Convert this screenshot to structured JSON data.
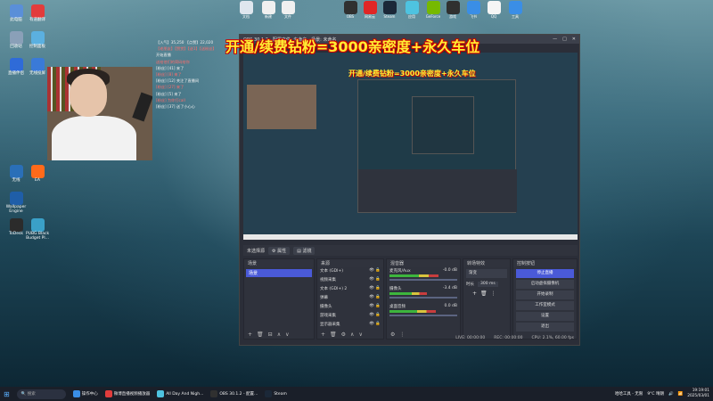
{
  "desktop": {
    "left_icons": [
      {
        "label": "此电脑",
        "color": "#5a8fd8",
        "icon": "computer-icon"
      },
      {
        "label": "有道翻译",
        "color": "#e23c3c",
        "icon": "youdao-icon"
      },
      {
        "label": "回收站",
        "color": "#8aa0b8",
        "icon": "recycle-bin-icon"
      },
      {
        "label": "控制面板",
        "color": "#5bb0e0",
        "icon": "control-panel-icon"
      },
      {
        "label": "直播伴侣",
        "color": "#2f6bd8",
        "icon": "app-icon"
      },
      {
        "label": "无线投屏",
        "color": "#3a7ad8",
        "icon": "cast-icon"
      },
      {
        "label": "无线",
        "color": "#2a6fb8",
        "icon": "wireless-icon"
      },
      {
        "label": "Wallpaper Engine",
        "color": "#1f5ea8",
        "icon": "wallpaper-engine-icon"
      },
      {
        "label": "EA",
        "color": "#ff6a1a",
        "icon": "ea-icon"
      },
      {
        "label": "ToDesk",
        "color": "#2b2b2b",
        "icon": "todesk-icon"
      },
      {
        "label": "PUBG Black Budget Pl...",
        "color": "#3aa0c8",
        "icon": "pubg-icon"
      }
    ],
    "top_icons": [
      {
        "label": "文档",
        "color": "#dfe6ee",
        "icon": "document-icon"
      },
      {
        "label": "新建",
        "color": "#f0f0f0",
        "icon": "file-icon"
      },
      {
        "label": "文件",
        "color": "#f0f0f0",
        "icon": "file-icon"
      },
      {
        "label": "OBS",
        "color": "#303030",
        "icon": "obs-icon"
      },
      {
        "label": "网易云",
        "color": "#e02626",
        "icon": "netease-music-icon"
      },
      {
        "label": "Steam",
        "color": "#1b2838",
        "icon": "steam-icon"
      },
      {
        "label": "应用",
        "color": "#4ec3e0",
        "icon": "app-icon"
      },
      {
        "label": "GeForce",
        "color": "#76b900",
        "icon": "nvidia-icon"
      },
      {
        "label": "游戏",
        "color": "#303030",
        "icon": "game-icon"
      },
      {
        "label": "飞书",
        "color": "#3a8ee6",
        "icon": "feishu-icon"
      },
      {
        "label": "QQ",
        "color": "#f5f5f5",
        "icon": "qq-icon"
      },
      {
        "label": "工具",
        "color": "#3a8ee6",
        "icon": "tool-icon"
      }
    ]
  },
  "overlay": {
    "banner": "开通/续费钻粉=3000亲密度+永久车位",
    "chat_lines": [
      "【入气】35,250 【点赞】22,020",
      "【老朋友】【赞赏】【送1】【送粉丝】",
      "开始直播",
      "送给他们的简码给你",
      "[粉丝] [41] 来了",
      "[粉丝] [8] 来了",
      "[粉丝] [12] 关注了直播间",
      "[粉丝] [27] 来了",
      "[粉丝] [5] 来了",
      "[粉丝] 为你打call",
      "[粉丝] [37] 送了小心心"
    ]
  },
  "obs": {
    "title": "OBS 30.1.2 - 配置文件: 未命名 - 场景: 未命名",
    "window_controls": [
      "—",
      "□",
      "✕"
    ],
    "preview_banner": "开通/续费钻粉=3000亲密度+永久车位",
    "toolbar": {
      "scene_label": "未选择源",
      "properties_label": "属性",
      "filters_label": "滤镜"
    },
    "scenes": {
      "header": "场景",
      "items": [
        "场景"
      ],
      "footer": [
        "+",
        "🗑",
        "⊟",
        "∧",
        "∨"
      ]
    },
    "sources": {
      "header": "来源",
      "items": [
        "文本 (GDI+)",
        "视频采集",
        "文本 (GDI+) 2",
        "弹幕",
        "摄像头",
        "游戏采集",
        "显示器采集"
      ],
      "footer": [
        "+",
        "🗑",
        "⚙",
        "∧",
        "∨"
      ]
    },
    "mixer": {
      "header": "混音器",
      "channels": [
        {
          "name": "麦克风/Aux",
          "db": "-0.0 dB",
          "level": 0.72
        },
        {
          "name": "摄像头",
          "db": "-3.4 dB",
          "level": 0.55
        },
        {
          "name": "桌面音频",
          "db": "0.0 dB",
          "level": 0.68
        }
      ]
    },
    "transitions": {
      "header": "转场特效",
      "type": "渐变",
      "duration_label": "时长",
      "duration_value": "300 ms"
    },
    "controls": {
      "header": "控制按钮",
      "buttons": [
        "停止直播",
        "启动虚拟摄像机",
        "开始录制",
        "工作室模式",
        "设置",
        "退出"
      ]
    },
    "status": {
      "live": "LIVE: 00:00:00",
      "rec": "REC: 00:00:00",
      "cpu": "CPU: 2.1%, 60.00 fps"
    }
  },
  "taskbar": {
    "search_placeholder": "搜索",
    "items": [
      {
        "label": "操作中心",
        "color": "#3a8ee6"
      },
      {
        "label": "微博直播视频播放器",
        "color": "#e23c3c"
      },
      {
        "label": "All Day And Nigh...",
        "color": "#4ec3e0"
      },
      {
        "label": "OBS 30.1.2 - 配置...",
        "color": "#303030"
      },
      {
        "label": "Steam",
        "color": "#1b2838"
      }
    ],
    "misc": "哈哈工具 - 无限",
    "weather": "9°C 晴朗",
    "time": "19:19:01",
    "date": "2025/03/01"
  }
}
